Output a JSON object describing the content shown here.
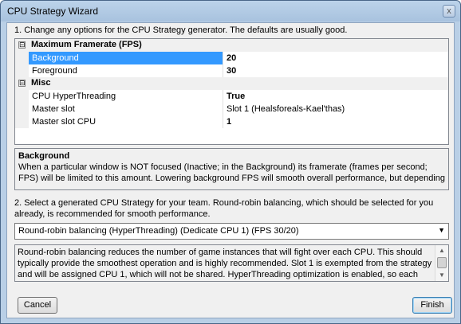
{
  "window": {
    "title": "CPU Strategy Wizard",
    "close_glyph": "x"
  },
  "step1": {
    "label": "1. Change any options for the CPU Strategy generator. The defaults are usually good."
  },
  "property_grid": {
    "expander_glyph": "⊟",
    "categories": [
      {
        "name": "Maximum Framerate (FPS)",
        "properties": [
          {
            "name": "Background",
            "value": "20",
            "selected": true,
            "bold": true
          },
          {
            "name": "Foreground",
            "value": "30",
            "selected": false,
            "bold": true
          }
        ]
      },
      {
        "name": "Misc",
        "properties": [
          {
            "name": "CPU HyperThreading",
            "value": "True",
            "selected": false,
            "bold": true
          },
          {
            "name": "Master slot",
            "value": "Slot 1 (Healsforeals-Kael'thas)",
            "selected": false,
            "bold": false
          },
          {
            "name": "Master slot CPU",
            "value": "1",
            "selected": false,
            "bold": true
          }
        ]
      }
    ]
  },
  "help": {
    "title": "Background",
    "description": "When a particular window is NOT focused (Inactive; in the Background) its framerate (frames per second; FPS) will be limited to this amount. Lowering background FPS will smooth overall performance, but depending on the..."
  },
  "step2": {
    "label": "2. Select a generated CPU Strategy for your team. Round-robin balancing, which should be selected for you already, is recommended for smooth performance."
  },
  "strategy_select": {
    "selected": "Round-robin balancing (HyperThreading) (Dedicate CPU 1) (FPS 30/20)"
  },
  "strategy_description": "Round-robin balancing reduces the number of game instances that will fight over each CPU. This should typically provide the smoothest operation and is highly recommended. Slot 1 is exempted from the strategy and will be assigned CPU 1, which will not be shared. HyperThreading optimization is enabled, so each Slot that would normally be assigned one CPU core by this strategy will use two.",
  "buttons": {
    "cancel": "Cancel",
    "finish": "Finish"
  },
  "icons": {
    "dropdown": "▼",
    "scroll_up": "▲",
    "scroll_down": "▼"
  }
}
